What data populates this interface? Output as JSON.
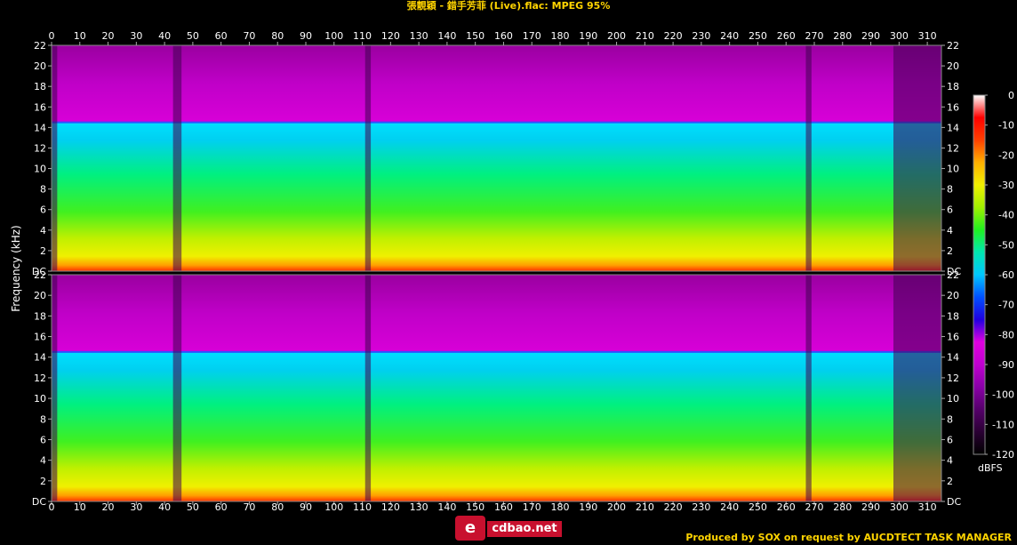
{
  "title": "張靚穎 - 錯手芳菲 (Live).flac: MPEG 95%",
  "footer": "Produced by SOX on request by AUCDTECT TASK MANAGER",
  "watermark": {
    "icon": "cdbao-logo-icon",
    "site": "cdbao.net"
  },
  "chart_data": {
    "type": "heatmap",
    "title": "張靚穎 - 錯手芳菲 (Live).flac: MPEG 95%",
    "xlabel": "",
    "ylabel": "Frequency (kHz)",
    "x_ticks": [
      0,
      10,
      20,
      30,
      40,
      50,
      60,
      70,
      80,
      90,
      100,
      110,
      120,
      130,
      140,
      150,
      160,
      170,
      180,
      190,
      200,
      210,
      220,
      230,
      240,
      250,
      260,
      270,
      280,
      290,
      300,
      310
    ],
    "xlim": [
      0,
      315
    ],
    "y_ticks": [
      "DC",
      "2",
      "4",
      "6",
      "8",
      "10",
      "12",
      "14",
      "16",
      "18",
      "20",
      "22"
    ],
    "ylim_khz": [
      0,
      22
    ],
    "channels": 2,
    "colorbar": {
      "unit": "dBFS",
      "ticks": [
        "0",
        "-10",
        "-20",
        "-30",
        "-40",
        "-50",
        "-60",
        "-70",
        "-80",
        "-90",
        "-100",
        "-110",
        "-120"
      ],
      "range": [
        -120,
        0
      ],
      "colors": [
        "#000000",
        "#2a0033",
        "#55006a",
        "#8a00a8",
        "#c000d0",
        "#e000e0",
        "#2000e0",
        "#0050ff",
        "#00c8ff",
        "#00e8b0",
        "#20f020",
        "#a0f000",
        "#f0f000",
        "#ffb000",
        "#ff4000",
        "#ff0000",
        "#ffffff"
      ]
    },
    "lowpass_cutoff_khz": 14.5,
    "cutoff_gaps": [
      [
        0,
        2
      ],
      [
        43,
        46
      ],
      [
        111,
        113
      ],
      [
        267,
        269
      ],
      [
        298,
        315
      ]
    ]
  }
}
